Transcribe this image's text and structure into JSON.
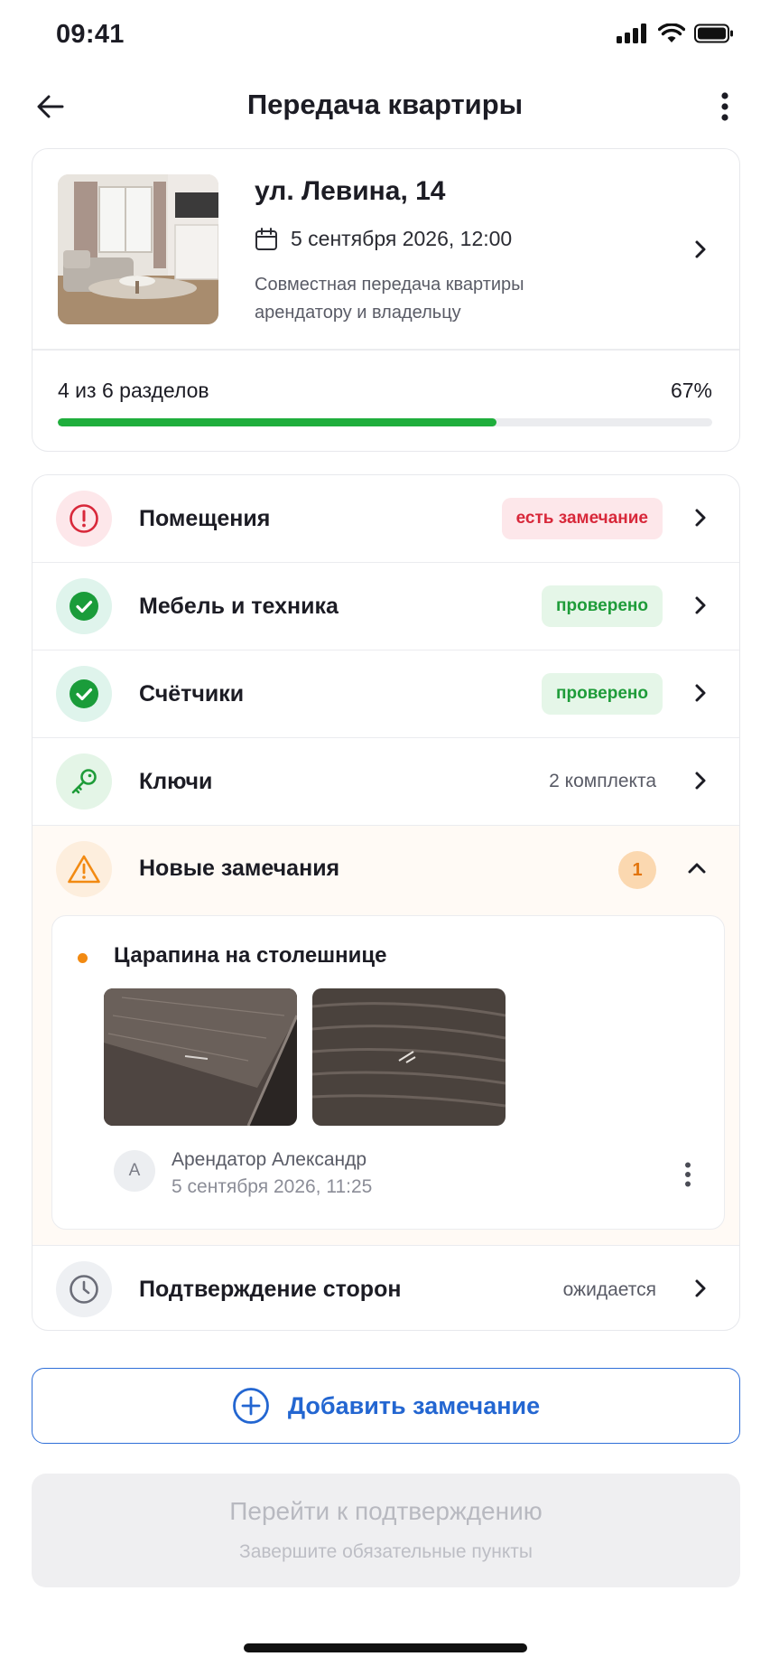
{
  "status_bar": {
    "time": "09:41"
  },
  "header": {
    "title": "Передача квартиры"
  },
  "summary": {
    "address": "ул. Левина, 14",
    "datetime": "5 сентября 2026, 12:00",
    "description": "Совместная передача квартиры арендатору и владельцу",
    "progress_label": "4 из 6 разделов",
    "progress_percent_text": "67%",
    "progress_fraction": 0.67
  },
  "sections": [
    {
      "label": "Помещения",
      "status": "есть замечание",
      "status_kind": "issue",
      "icon": "alert-circle-icon"
    },
    {
      "label": "Мебель и техника",
      "status": "проверено",
      "status_kind": "ok",
      "icon": "check-circle-icon"
    },
    {
      "label": "Счётчики",
      "status": "проверено",
      "status_kind": "ok",
      "icon": "check-circle-icon"
    },
    {
      "label": "Ключи",
      "meta": "2 комплекта",
      "icon": "key-icon"
    }
  ],
  "issues": {
    "label": "Новые замечания",
    "count": "1",
    "items": [
      {
        "title": "Царапина на столешнице",
        "author_initial": "А",
        "author": "Арендатор Александр",
        "timestamp": "5 сентября 2026, 11:25"
      }
    ]
  },
  "confirmation": {
    "label": "Подтверждение сторон",
    "meta": "ожидается",
    "icon": "clock-icon"
  },
  "actions": {
    "add_issue": "Добавить замечание",
    "proceed_title": "Перейти к подтверждению",
    "proceed_subtitle": "Завершите обязательные пункты"
  },
  "colors": {
    "accent_blue": "#2366d1",
    "success_green": "#1fae3c",
    "error_red": "#d8283a",
    "warning_orange": "#f28a12"
  }
}
